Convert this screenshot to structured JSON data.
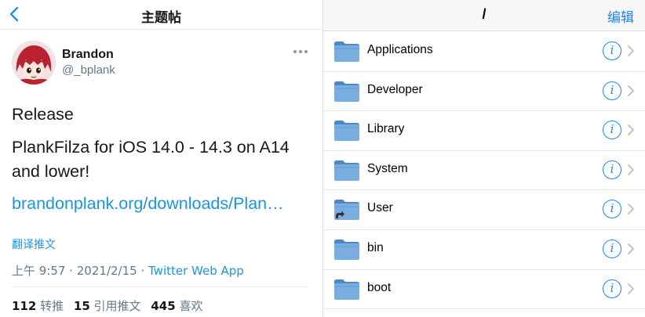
{
  "tweet_screen": {
    "nav": {
      "title": "主题帖"
    },
    "author": {
      "name": "Brandon",
      "handle": "@_bplank"
    },
    "text_lines": [
      "Release",
      "PlankFilza for iOS 14.0 - 14.3 on A14",
      "and lower!"
    ],
    "link": "brandonplank.org/downloads/Plan…",
    "translate": "翻译推文",
    "meta": {
      "time": "上午 9:57",
      "dot1": " · ",
      "date": "2021/2/15",
      "dot2": " · ",
      "source": "Twitter Web App"
    },
    "stats": [
      {
        "count": "112",
        "label": "转推"
      },
      {
        "count": "15",
        "label": "引用推文"
      },
      {
        "count": "445",
        "label": "喜欢"
      }
    ]
  },
  "file_screen": {
    "nav": {
      "path": "/",
      "edit_label": "编辑"
    },
    "items": [
      {
        "name": "Applications",
        "icon": "folder-icon"
      },
      {
        "name": "Developer",
        "icon": "folder-icon"
      },
      {
        "name": "Library",
        "icon": "folder-icon"
      },
      {
        "name": "System",
        "icon": "folder-icon"
      },
      {
        "name": "User",
        "icon": "folder-alias-icon"
      },
      {
        "name": "bin",
        "icon": "folder-icon"
      },
      {
        "name": "boot",
        "icon": "folder-icon"
      }
    ],
    "info_glyph": "i"
  },
  "colors": {
    "twitter_blue": "#1b95e0",
    "ios_blue": "#1a84ff",
    "folder_blue": "#6fa3d8"
  }
}
